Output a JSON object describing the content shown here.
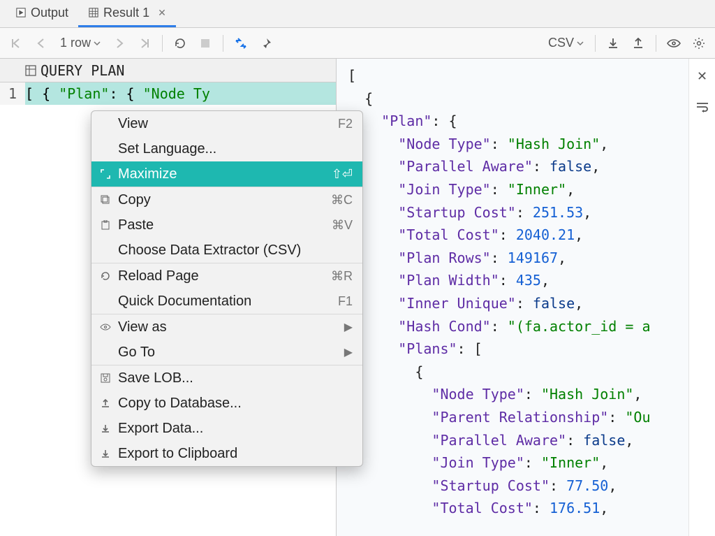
{
  "tabs": {
    "output": "Output",
    "result": "Result 1"
  },
  "toolbar": {
    "rows": "1 row",
    "extractor": "CSV"
  },
  "grid": {
    "column_header": "QUERY PLAN",
    "row_number": "1",
    "cell_preview_keys": {
      "plan": "\"Plan\"",
      "node": "\"Node Ty"
    },
    "cell_preview_syms": {
      "open": "[",
      "brace": "{",
      "colon": ":",
      "brace2": "{"
    }
  },
  "ctx": {
    "view": {
      "label": "View",
      "short": "F2"
    },
    "set_language": {
      "label": "Set Language..."
    },
    "maximize": {
      "label": "Maximize",
      "short": "⇧⏎"
    },
    "copy": {
      "label": "Copy",
      "short": "⌘C"
    },
    "paste": {
      "label": "Paste",
      "short": "⌘V"
    },
    "choose_extractor": {
      "label": "Choose Data Extractor (CSV)"
    },
    "reload": {
      "label": "Reload Page",
      "short": "⌘R"
    },
    "quick_doc": {
      "label": "Quick Documentation",
      "short": "F1"
    },
    "view_as": {
      "label": "View as"
    },
    "go_to": {
      "label": "Go To"
    },
    "save_lob": {
      "label": "Save LOB..."
    },
    "copy_db": {
      "label": "Copy to Database..."
    },
    "export_data": {
      "label": "Export Data..."
    },
    "export_clip": {
      "label": "Export to Clipboard"
    }
  },
  "json_preview": {
    "lines": [
      {
        "indent": 0,
        "tokens": [
          {
            "t": "p",
            "v": "["
          }
        ]
      },
      {
        "indent": 1,
        "tokens": [
          {
            "t": "p",
            "v": "{"
          }
        ]
      },
      {
        "indent": 2,
        "tokens": [
          {
            "t": "k",
            "v": "\"Plan\""
          },
          {
            "t": "p",
            "v": ": {"
          }
        ]
      },
      {
        "indent": 3,
        "tokens": [
          {
            "t": "k",
            "v": "\"Node Type\""
          },
          {
            "t": "p",
            "v": ": "
          },
          {
            "t": "s",
            "v": "\"Hash Join\""
          },
          {
            "t": "p",
            "v": ","
          }
        ]
      },
      {
        "indent": 3,
        "tokens": [
          {
            "t": "k",
            "v": "\"Parallel Aware\""
          },
          {
            "t": "p",
            "v": ": "
          },
          {
            "t": "b",
            "v": "false"
          },
          {
            "t": "p",
            "v": ","
          }
        ]
      },
      {
        "indent": 3,
        "tokens": [
          {
            "t": "k",
            "v": "\"Join Type\""
          },
          {
            "t": "p",
            "v": ": "
          },
          {
            "t": "s",
            "v": "\"Inner\""
          },
          {
            "t": "p",
            "v": ","
          }
        ]
      },
      {
        "indent": 3,
        "tokens": [
          {
            "t": "k",
            "v": "\"Startup Cost\""
          },
          {
            "t": "p",
            "v": ": "
          },
          {
            "t": "n",
            "v": "251.53"
          },
          {
            "t": "p",
            "v": ","
          }
        ]
      },
      {
        "indent": 3,
        "tokens": [
          {
            "t": "k",
            "v": "\"Total Cost\""
          },
          {
            "t": "p",
            "v": ": "
          },
          {
            "t": "n",
            "v": "2040.21"
          },
          {
            "t": "p",
            "v": ","
          }
        ]
      },
      {
        "indent": 3,
        "tokens": [
          {
            "t": "k",
            "v": "\"Plan Rows\""
          },
          {
            "t": "p",
            "v": ": "
          },
          {
            "t": "n",
            "v": "149167"
          },
          {
            "t": "p",
            "v": ","
          }
        ]
      },
      {
        "indent": 3,
        "tokens": [
          {
            "t": "k",
            "v": "\"Plan Width\""
          },
          {
            "t": "p",
            "v": ": "
          },
          {
            "t": "n",
            "v": "435"
          },
          {
            "t": "p",
            "v": ","
          }
        ]
      },
      {
        "indent": 3,
        "tokens": [
          {
            "t": "k",
            "v": "\"Inner Unique\""
          },
          {
            "t": "p",
            "v": ": "
          },
          {
            "t": "b",
            "v": "false"
          },
          {
            "t": "p",
            "v": ","
          }
        ]
      },
      {
        "indent": 3,
        "tokens": [
          {
            "t": "k",
            "v": "\"Hash Cond\""
          },
          {
            "t": "p",
            "v": ": "
          },
          {
            "t": "s",
            "v": "\"(fa.actor_id = a"
          }
        ]
      },
      {
        "indent": 3,
        "tokens": [
          {
            "t": "k",
            "v": "\"Plans\""
          },
          {
            "t": "p",
            "v": ": ["
          }
        ]
      },
      {
        "indent": 4,
        "tokens": [
          {
            "t": "p",
            "v": "{"
          }
        ]
      },
      {
        "indent": 5,
        "tokens": [
          {
            "t": "k",
            "v": "\"Node Type\""
          },
          {
            "t": "p",
            "v": ": "
          },
          {
            "t": "s",
            "v": "\"Hash Join\""
          },
          {
            "t": "p",
            "v": ","
          }
        ]
      },
      {
        "indent": 5,
        "tokens": [
          {
            "t": "k",
            "v": "\"Parent Relationship\""
          },
          {
            "t": "p",
            "v": ": "
          },
          {
            "t": "s",
            "v": "\"Ou"
          }
        ]
      },
      {
        "indent": 5,
        "tokens": [
          {
            "t": "k",
            "v": "\"Parallel Aware\""
          },
          {
            "t": "p",
            "v": ": "
          },
          {
            "t": "b",
            "v": "false"
          },
          {
            "t": "p",
            "v": ","
          }
        ]
      },
      {
        "indent": 5,
        "tokens": [
          {
            "t": "k",
            "v": "\"Join Type\""
          },
          {
            "t": "p",
            "v": ": "
          },
          {
            "t": "s",
            "v": "\"Inner\""
          },
          {
            "t": "p",
            "v": ","
          }
        ]
      },
      {
        "indent": 5,
        "tokens": [
          {
            "t": "k",
            "v": "\"Startup Cost\""
          },
          {
            "t": "p",
            "v": ": "
          },
          {
            "t": "n",
            "v": "77.50"
          },
          {
            "t": "p",
            "v": ","
          }
        ]
      },
      {
        "indent": 5,
        "tokens": [
          {
            "t": "k",
            "v": "\"Total Cost\""
          },
          {
            "t": "p",
            "v": ": "
          },
          {
            "t": "n",
            "v": "176.51"
          },
          {
            "t": "p",
            "v": ","
          }
        ]
      }
    ]
  }
}
